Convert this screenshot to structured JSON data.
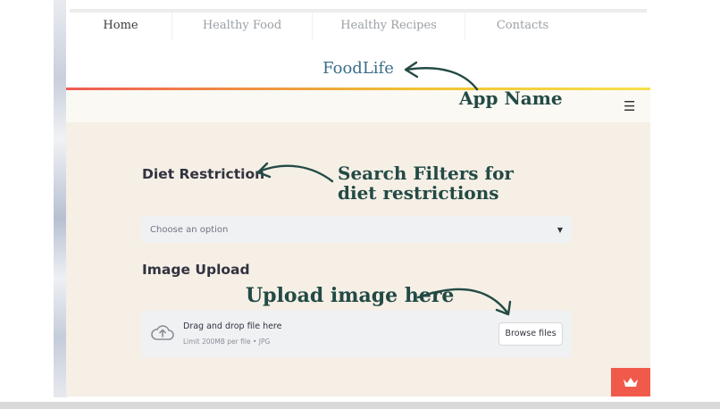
{
  "nav": {
    "items": [
      {
        "label": "Home"
      },
      {
        "label": "Healthy Food"
      },
      {
        "label": "Healthy Recipes"
      },
      {
        "label": "Contacts"
      }
    ]
  },
  "header": {
    "app_name": "FoodLife"
  },
  "diet": {
    "title": "Diet Restriction",
    "select_placeholder": "Choose an option"
  },
  "upload": {
    "title": "Image Upload",
    "drop_text": "Drag and drop file here",
    "limit_text": "Limit 200MB per file • JPG",
    "browse_label": "Browse files"
  },
  "annotations": {
    "app_name": "App Name",
    "filters_line1": "Search Filters for",
    "filters_line2": "diet restrictions",
    "upload": "Upload image here"
  },
  "colors": {
    "accent_blue": "#3b6e8a",
    "annotation_green": "#234a45",
    "badge_red": "#f05a4b",
    "main_bg": "#f5efe6"
  },
  "icons": [
    "menu-icon",
    "upload-cloud-icon",
    "crown-icon",
    "caret-down-icon"
  ]
}
